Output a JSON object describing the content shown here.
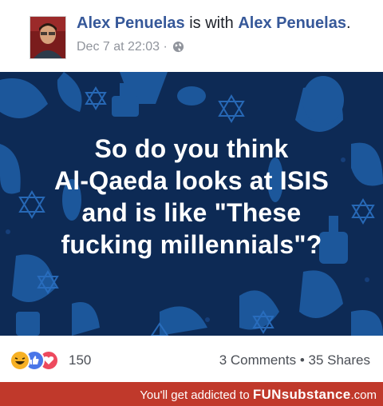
{
  "post": {
    "author": "Alex Penuelas",
    "with_text": "is with",
    "tagged": "Alex Penuelas",
    "period": ".",
    "timestamp": "Dec 7 at 22:03",
    "separator": "·",
    "privacy_icon": "globe-icon"
  },
  "image": {
    "lines": [
      "So do you think",
      "Al-Qaeda looks at ISIS",
      "and is like \"These",
      "fucking millennials\"?"
    ],
    "background_color": "#0d2a55",
    "pattern_color": "#1f5fa8"
  },
  "footer": {
    "reactions": [
      "haha-icon",
      "like-icon",
      "love-icon"
    ],
    "reaction_count": "150",
    "comments": "3 Comments",
    "dot": "•",
    "shares": "35 Shares"
  },
  "banner": {
    "prefix": "You'll get addicted to",
    "brand": "FUNsubstance",
    "suffix": ".com",
    "color": "#c0392b"
  }
}
